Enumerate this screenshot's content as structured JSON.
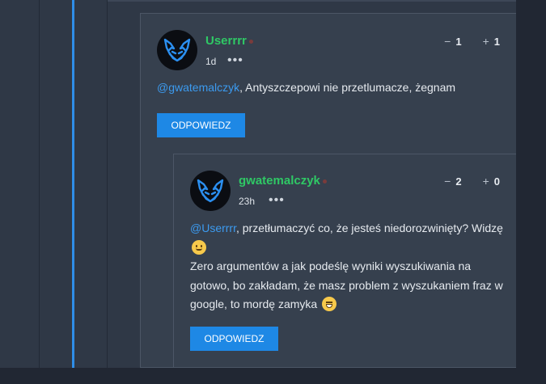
{
  "comments": [
    {
      "username": "Userrrr",
      "time": "1d",
      "more": "•••",
      "downvote_icon": "−",
      "downvotes": "1",
      "upvote_icon": "+",
      "upvotes": "1",
      "mention": "@gwatemalczyk",
      "text": ", Antyszczepowi nie przetlumacze, żegnam",
      "reply_label": "ODPOWIEDZ"
    },
    {
      "username": "gwatemalczyk",
      "time": "23h",
      "more": "•••",
      "downvote_icon": "−",
      "downvotes": "2",
      "upvote_icon": "+",
      "upvotes": "0",
      "mention": "@Userrrr",
      "text_line1": ", przetłumaczyć co, że jesteś niedorozwinięty? Widzę",
      "text_line2": "Zero argumentów a jak podeślę wyniki wyszukiwania na gotowo, bo zakładam, że masz problem z wyszukaniem fraz w google, to mordę zamyka",
      "reply_label": "ODPOWIEDZ"
    }
  ],
  "colors": {
    "accent": "#1e88e5",
    "username": "#2fc865",
    "mention": "#3c9bf0",
    "thread_line": "#2f8ee8"
  },
  "icons": {
    "avatar": "wolf-logo-icon",
    "emoji1": "slightly-smiling-face-icon",
    "emoji2": "grinning-squinting-face-icon"
  }
}
